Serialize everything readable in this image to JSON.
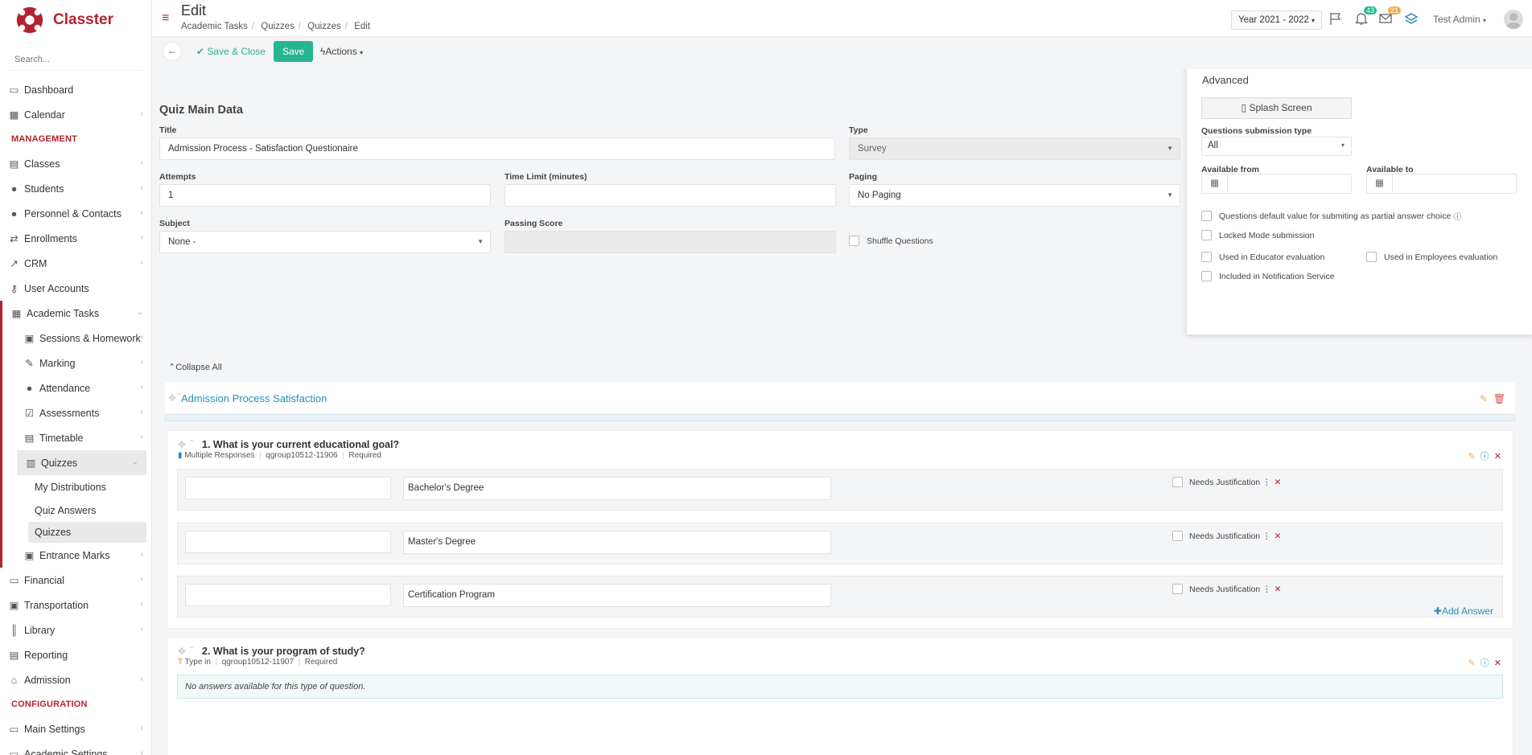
{
  "brand": {
    "name": "Classter",
    "color": "#b3232f",
    "accent": "#26b58f",
    "link": "#2b8fb4"
  },
  "sidebar": {
    "search_placeholder": "Search...",
    "items": [
      {
        "label": "Dashboard",
        "icon": "laptop-icon"
      },
      {
        "label": "Calendar",
        "icon": "calendar-icon"
      }
    ],
    "management_header": "MANAGEMENT",
    "management": [
      {
        "label": "Classes",
        "icon": "classes-icon"
      },
      {
        "label": "Students",
        "icon": "students-icon"
      },
      {
        "label": "Personnel & Contacts",
        "icon": "personnel-icon"
      },
      {
        "label": "Enrollments",
        "icon": "exchange-icon"
      },
      {
        "label": "CRM",
        "icon": "crm-icon"
      },
      {
        "label": "User Accounts",
        "icon": "key-icon"
      }
    ],
    "academic_tasks": {
      "label": "Academic Tasks",
      "children": [
        {
          "label": "Sessions & Homework"
        },
        {
          "label": "Marking"
        },
        {
          "label": "Attendance"
        },
        {
          "label": "Assessments"
        },
        {
          "label": "Timetable"
        },
        {
          "label": "Quizzes",
          "children": [
            {
              "label": "My Distributions"
            },
            {
              "label": "Quiz Answers"
            },
            {
              "label": "Quizzes"
            }
          ]
        },
        {
          "label": "Entrance Marks"
        }
      ]
    },
    "more": [
      {
        "label": "Financial"
      },
      {
        "label": "Transportation"
      },
      {
        "label": "Library"
      },
      {
        "label": "Reporting"
      },
      {
        "label": "Admission"
      }
    ],
    "configuration_header": "CONFIGURATION",
    "configuration": [
      {
        "label": "Main Settings"
      },
      {
        "label": "Academic Settings"
      }
    ]
  },
  "topbar": {
    "title": "Edit",
    "breadcrumbs": [
      "Academic Tasks",
      "Quizzes",
      "Quizzes",
      "Edit"
    ],
    "year": "Year 2021 - 2022",
    "notif_count": "43",
    "mail_count": "21",
    "user": "Test Admin"
  },
  "toolbar": {
    "save_close": "Save & Close",
    "save": "Save",
    "actions": "Actions"
  },
  "quiz": {
    "section_title": "Quiz Main Data",
    "title_label": "Title",
    "title_value": "Admission Process - Satisfaction Questionaire",
    "type_label": "Type",
    "type_value": "Survey",
    "attempts_label": "Attempts",
    "attempts_value": "1",
    "time_limit_label": "Time Limit (minutes)",
    "time_limit_value": "",
    "paging_label": "Paging",
    "paging_value": "No Paging",
    "subject_label": "Subject",
    "subject_value": "None -",
    "passing_label": "Passing Score",
    "shuffle_label": "Shuffle Questions"
  },
  "advanced": {
    "title": "Advanced",
    "splash": "Splash Screen",
    "submission_label": "Questions submission type",
    "submission_value": "All",
    "available_from": "Available from",
    "available_to": "Available to",
    "opt1": "Questions default value for submiting as partial answer choice",
    "opt2": "Locked Mode submission",
    "opt3": "Used in Educator evaluation",
    "opt4": "Used in Employees evaluation",
    "opt5": "Included in Notification Service"
  },
  "collapse_all": "Collapse All",
  "group_title": "Admission Process Satisfaction",
  "q1": {
    "title": "1. What is your current educational goal?",
    "type": "Multiple Responses",
    "code": "qgroup10512-11906",
    "required": "Required",
    "answers": [
      "Bachelor's Degree",
      "Master's Degree",
      "Certification Program"
    ],
    "nj": "Needs Justification",
    "add": "Add Answer"
  },
  "q2": {
    "title": "2. What is your program of study?",
    "type": "Type in",
    "code": "qgroup10512-11907",
    "required": "Required",
    "none": "No answers available for this type of question."
  }
}
